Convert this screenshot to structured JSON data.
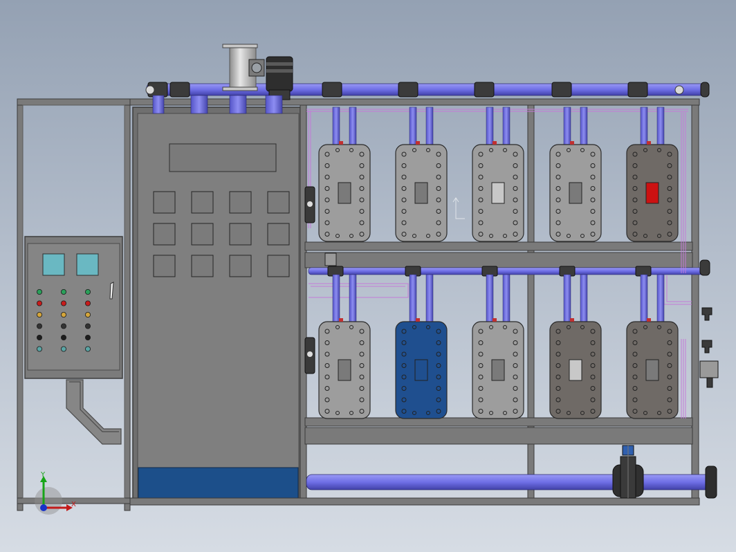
{
  "viewport": {
    "background": "#a9b4c3"
  },
  "colors": {
    "frame": "#6e6e6e",
    "frame_light": "#8a8a8a",
    "panel": "#7d7d7d",
    "pipe": "#6f6fe6",
    "pipe_dark": "#4a4ab8",
    "module_light": "#9d9d9d",
    "module_dark": "#6f6a66",
    "module_blue": "#1f4f8f",
    "indicator_red": "#cc1111",
    "screen": "#6ab8c2",
    "blue_base": "#1c4f8a",
    "wire": "#c47ad8"
  },
  "triad": {
    "x_label": "X",
    "y_label": "Y"
  },
  "lamp_colors": [
    [
      "#2aa05a",
      "#2aa05a",
      "#2aa05a"
    ],
    [
      "#c81b1b",
      "#c81b1b",
      "#c81b1b"
    ],
    [
      "#d3a53b",
      "#d3a53b",
      "#d3a53b"
    ],
    [
      "#333333",
      "#333333",
      "#333333"
    ],
    [
      "#1d1d1d",
      "#1d1d1d",
      "#1d1d1d"
    ],
    [
      "#5aa5a5",
      "#5aa5a5",
      "#5aa5a5"
    ]
  ],
  "upper_modules": [
    {
      "body": "module_light",
      "window": "#7a7a7a"
    },
    {
      "body": "module_light",
      "window": "#7a7a7a"
    },
    {
      "body": "module_light",
      "window": "#c8c8c8"
    },
    {
      "body": "module_light",
      "window": "#7a7a7a"
    },
    {
      "body": "module_dark",
      "window": "#cc1111"
    }
  ],
  "lower_modules": [
    {
      "body": "module_light",
      "window": "#7a7a7a"
    },
    {
      "body": "module_blue",
      "window": "#1f4f8f"
    },
    {
      "body": "module_light",
      "window": "#7a7a7a"
    },
    {
      "body": "module_dark",
      "window": "#c8c8c8"
    },
    {
      "body": "module_dark",
      "window": "#7a7a7a"
    }
  ]
}
